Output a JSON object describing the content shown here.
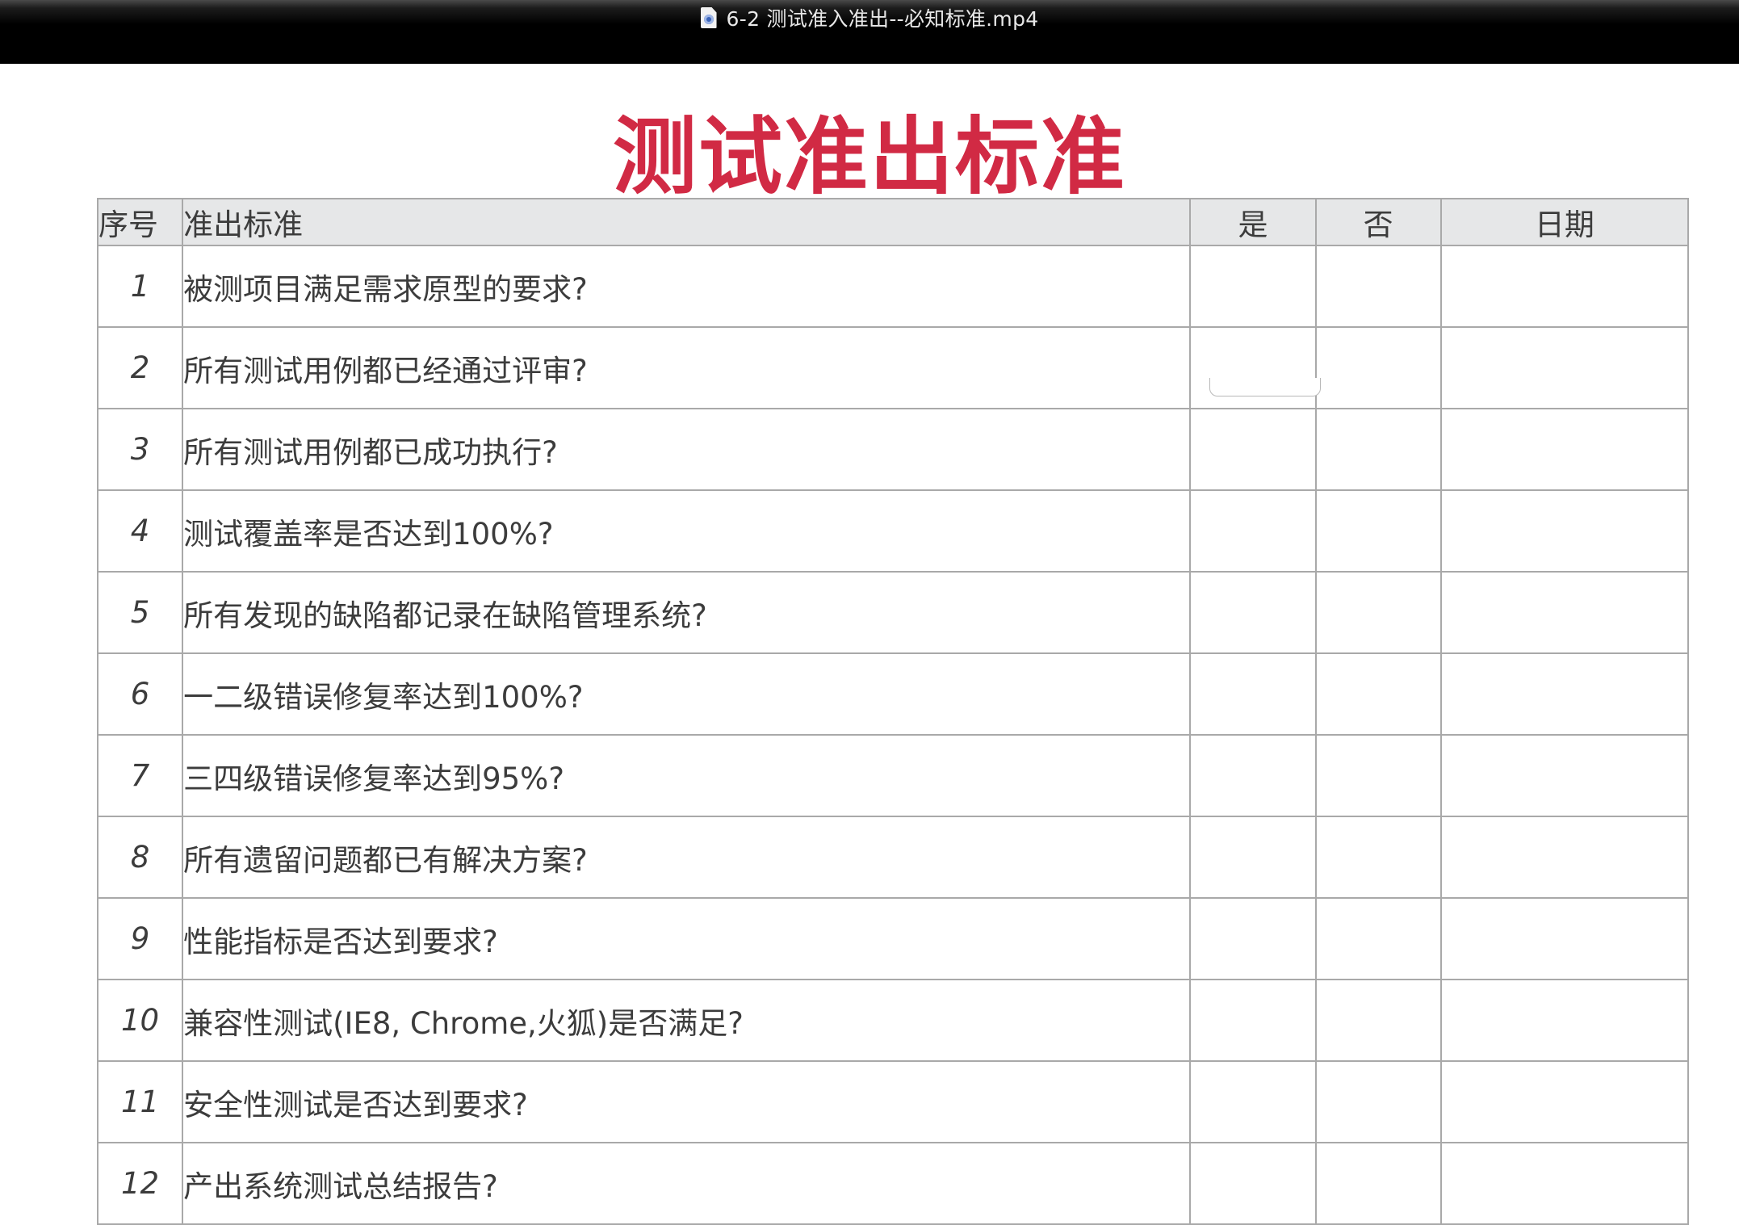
{
  "window": {
    "title": "6-2 测试准入准出--必知标准.mp4",
    "file_icon": "quicktime-file-icon"
  },
  "slide": {
    "title": "测试准出标准"
  },
  "table": {
    "headers": [
      "序号",
      "准出标准",
      "是",
      "否",
      "日期"
    ],
    "rows": [
      {
        "num": "1",
        "text": "被测项目满足需求原型的要求?"
      },
      {
        "num": "2",
        "text": "所有测试用例都已经通过评审?"
      },
      {
        "num": "3",
        "text": "所有测试用例都已成功执行?"
      },
      {
        "num": "4",
        "text": "测试覆盖率是否达到100%?"
      },
      {
        "num": "5",
        "text": "所有发现的缺陷都记录在缺陷管理系统?"
      },
      {
        "num": "6",
        "text": "一二级错误修复率达到100%?"
      },
      {
        "num": "7",
        "text": "三四级错误修复率达到95%?"
      },
      {
        "num": "8",
        "text": "所有遗留问题都已有解决方案?"
      },
      {
        "num": "9",
        "text": "性能指标是否达到要求?"
      },
      {
        "num": "10",
        "text": "兼容性测试(IE8, Chrome,火狐)是否满足?"
      },
      {
        "num": "11",
        "text": "安全性测试是否达到要求?"
      },
      {
        "num": "12",
        "text": "产出系统测试总结报告?"
      }
    ]
  },
  "colors": {
    "title_red": "#d12a44",
    "header_bg": "#e6e7e8",
    "border": "#a9a9a9",
    "text": "#3c3c3c"
  }
}
